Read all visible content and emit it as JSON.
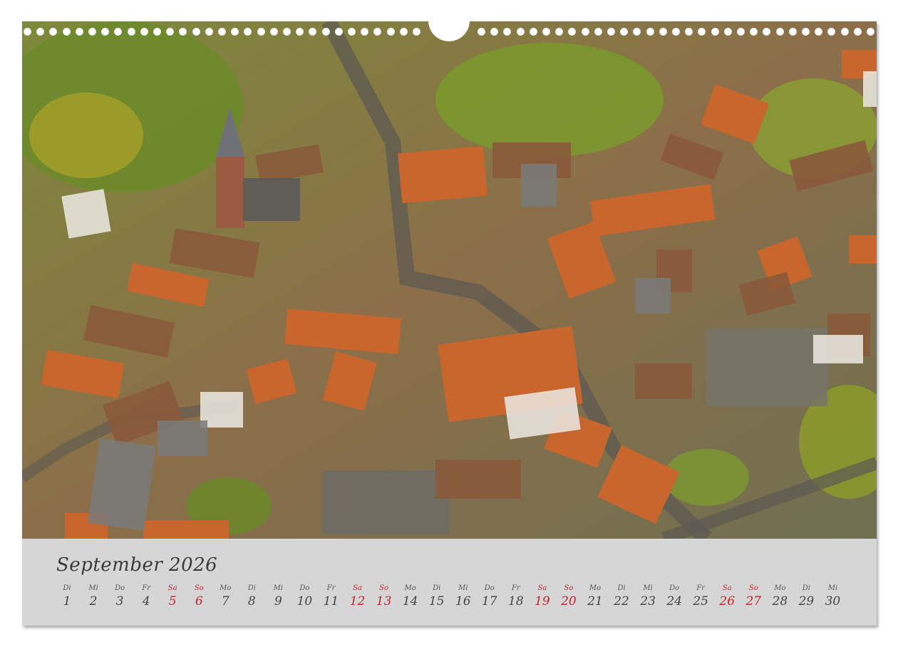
{
  "calendar": {
    "month_title": "September 2026",
    "days": [
      {
        "wd": "Di",
        "d": "1",
        "weekend": false
      },
      {
        "wd": "Mi",
        "d": "2",
        "weekend": false
      },
      {
        "wd": "Do",
        "d": "3",
        "weekend": false
      },
      {
        "wd": "Fr",
        "d": "4",
        "weekend": false
      },
      {
        "wd": "Sa",
        "d": "5",
        "weekend": true
      },
      {
        "wd": "So",
        "d": "6",
        "weekend": true
      },
      {
        "wd": "Mo",
        "d": "7",
        "weekend": false
      },
      {
        "wd": "Di",
        "d": "8",
        "weekend": false
      },
      {
        "wd": "Mi",
        "d": "9",
        "weekend": false
      },
      {
        "wd": "Do",
        "d": "10",
        "weekend": false
      },
      {
        "wd": "Fr",
        "d": "11",
        "weekend": false
      },
      {
        "wd": "Sa",
        "d": "12",
        "weekend": true
      },
      {
        "wd": "So",
        "d": "13",
        "weekend": true
      },
      {
        "wd": "Mo",
        "d": "14",
        "weekend": false
      },
      {
        "wd": "Di",
        "d": "15",
        "weekend": false
      },
      {
        "wd": "Mi",
        "d": "16",
        "weekend": false
      },
      {
        "wd": "Do",
        "d": "17",
        "weekend": false
      },
      {
        "wd": "Fr",
        "d": "18",
        "weekend": false
      },
      {
        "wd": "Sa",
        "d": "19",
        "weekend": true
      },
      {
        "wd": "So",
        "d": "20",
        "weekend": true
      },
      {
        "wd": "Mo",
        "d": "21",
        "weekend": false
      },
      {
        "wd": "Di",
        "d": "22",
        "weekend": false
      },
      {
        "wd": "Mi",
        "d": "23",
        "weekend": false
      },
      {
        "wd": "Do",
        "d": "24",
        "weekend": false
      },
      {
        "wd": "Fr",
        "d": "25",
        "weekend": false
      },
      {
        "wd": "Sa",
        "d": "26",
        "weekend": true
      },
      {
        "wd": "So",
        "d": "27",
        "weekend": true
      },
      {
        "wd": "Mo",
        "d": "28",
        "weekend": false
      },
      {
        "wd": "Di",
        "d": "29",
        "weekend": false
      },
      {
        "wd": "Mi",
        "d": "30",
        "weekend": false
      }
    ]
  },
  "colors": {
    "weekend": "#c0262d",
    "weekday": "#444444",
    "panel": "#d6d6d6"
  }
}
